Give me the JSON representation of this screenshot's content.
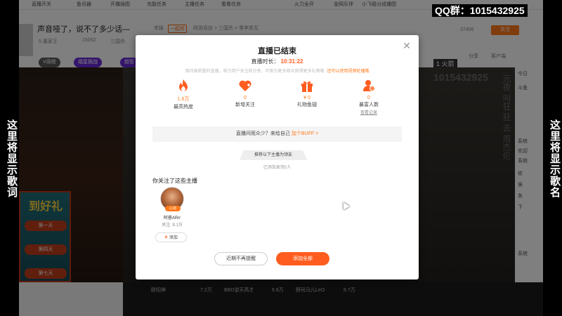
{
  "side_left_text": "这里将显示歌词",
  "side_right_text": "这里将显示歌名",
  "qq_banner": "QQ群：1015432925",
  "background": {
    "nav_items": [
      "直播开关",
      "鱼讯器",
      "开播插图",
      "充能任务",
      "主播任务",
      "看看任务",
      "火力全开",
      "金网乐伴",
      "小飞碰分成播图"
    ],
    "room_title": "声音哑了，说不了多少话—",
    "room_tags": [
      "举报",
      "一起听",
      "网游竞技 > 三国杀 > 零李类互"
    ],
    "room_meta": [
      "5 愚家王",
      "15052",
      "三国杀"
    ],
    "follow_count": "37406",
    "follow_label": "关注",
    "fire_badge": "1 火箭",
    "header_right": [
      "分享",
      "客户端"
    ],
    "pills": [
      "V周榜",
      "福星挑战",
      "超管"
    ],
    "gift_title": "到好礼",
    "gift_rows": [
      "第一天",
      "第四天",
      "第七天"
    ],
    "watermark_id": "1015432925",
    "watermark_logo": "斗鱼",
    "watermark_vert": "元夜 叫狂 狂 去 周杰伦",
    "right_panel": [
      "今日",
      "系统",
      "欢迎",
      "系统",
      "依",
      "侯",
      "各",
      "下",
      "系统"
    ],
    "bottom_recs": [
      {
        "name": "欧阳神",
        "count": "7.2万"
      },
      {
        "name": "BBD逆天高才",
        "count": "6.8万"
      },
      {
        "name": "野司马儿LeO",
        "count": "6.7万"
      }
    ]
  },
  "modal": {
    "title": "直播已结束",
    "duration_label": "直播时长：",
    "duration_value": "10:31:22",
    "notice_text": "保持高质量的直播，吸引用户关注和分享，可吸引更多观众获得更多礼物哦",
    "notice_link": "还可以使用视频轮播哦",
    "stats": [
      {
        "icon": "fire-icon",
        "value": "1.6万",
        "label": "最高热度",
        "link": ""
      },
      {
        "icon": "heart-plus-icon",
        "value": "0",
        "label": "新增关注",
        "link": ""
      },
      {
        "icon": "gift-icon",
        "value": "¥ 0",
        "label": "礼物鱼翅",
        "link": ""
      },
      {
        "icon": "fans-icon",
        "value": "0",
        "label": "暴富人数",
        "link": "查看记录"
      }
    ],
    "buff_text": "直播间观众少？来给自己",
    "buff_link": "加个BUFF >",
    "recommend_tab": "推荐以下主播为领友",
    "collect_note": "已添加发领2人",
    "followed_title": "你关注了这些主播",
    "streamer": {
      "avatar_badge": "心动",
      "name": "阿睿ARrr",
      "fans": "关注: 8.1万",
      "add_label": "添加"
    },
    "btn_later": "近期不再提醒",
    "btn_addall": "添加全部"
  },
  "colors": {
    "accent": "#ff5d1f",
    "link": "#ff7a1a"
  }
}
